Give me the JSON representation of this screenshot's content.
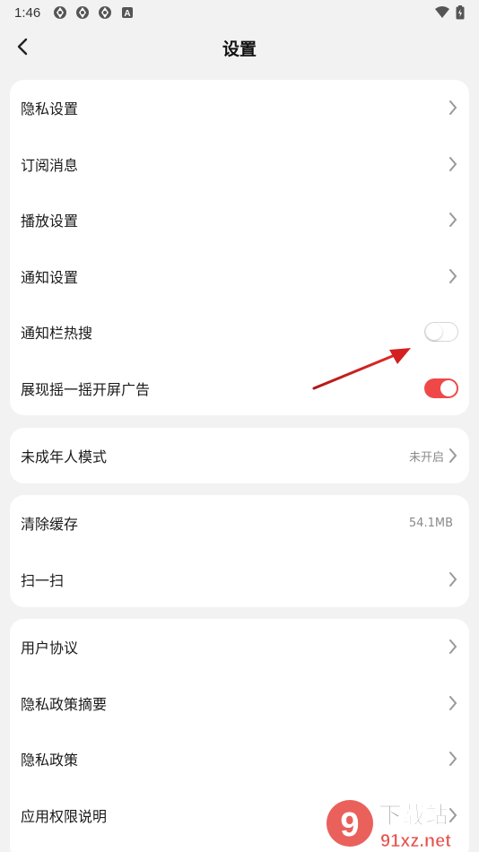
{
  "status_bar": {
    "time": "1:46",
    "icons": [
      "app-notification-icon",
      "app-notification-icon",
      "app-notification-icon",
      "a-badge-icon"
    ],
    "badge_letter": "A",
    "right_icons": [
      "wifi-icon",
      "battery-icon"
    ]
  },
  "header": {
    "title": "设置",
    "back_icon": "chevron-left-icon"
  },
  "groups": [
    {
      "items": [
        {
          "label": "隐私设置",
          "control": "chevron"
        },
        {
          "label": "订阅消息",
          "control": "chevron"
        },
        {
          "label": "播放设置",
          "control": "chevron"
        },
        {
          "label": "通知设置",
          "control": "chevron"
        },
        {
          "label": "通知栏热搜",
          "control": "toggle",
          "on": false
        },
        {
          "label": "展现摇一摇开屏广告",
          "control": "toggle",
          "on": true
        }
      ]
    },
    {
      "items": [
        {
          "label": "未成年人模式",
          "value": "未开启",
          "control": "chevron"
        }
      ]
    },
    {
      "items": [
        {
          "label": "清除缓存",
          "value": "54.1MB",
          "control": "none"
        },
        {
          "label": "扫一扫",
          "control": "chevron"
        }
      ]
    },
    {
      "items": [
        {
          "label": "用户协议",
          "control": "chevron"
        },
        {
          "label": "隐私政策摘要",
          "control": "chevron"
        },
        {
          "label": "隐私政策",
          "control": "chevron"
        },
        {
          "label": "应用权限说明",
          "control": "chevron"
        }
      ]
    }
  ],
  "colors": {
    "accent": "#f04848",
    "annotation_arrow": "#d42020",
    "background": "#f2f2f2",
    "card": "#ffffff"
  },
  "watermark": {
    "brand": "下载站",
    "domain": "91xz.net",
    "logo_text": "9"
  }
}
